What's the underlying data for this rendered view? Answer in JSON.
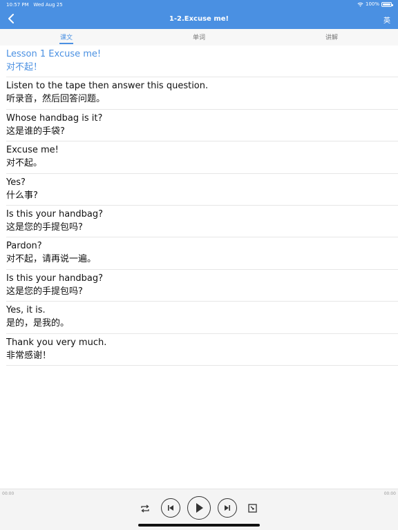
{
  "status_bar": {
    "time": "10:57 PM",
    "date": "Wed Aug 25",
    "battery": "100%"
  },
  "header": {
    "title": "1-2.Excuse me!",
    "lang_toggle": "英",
    "back_icon": "chevron-left-icon"
  },
  "tabs": [
    {
      "label": "课文",
      "active": true
    },
    {
      "label": "单词",
      "active": false
    },
    {
      "label": "讲解",
      "active": false
    }
  ],
  "lines": [
    {
      "en": "Lesson 1 Excuse me!",
      "zh": "对不起！"
    },
    {
      "en": "Listen to the tape then answer this question.",
      "zh": "听录音，然后回答问题。"
    },
    {
      "en": "Whose handbag is it?",
      "zh": "这是谁的手袋?"
    },
    {
      "en": "Excuse me!",
      "zh": "对不起。"
    },
    {
      "en": "Yes?",
      "zh": "什么事?"
    },
    {
      "en": "Is this your handbag?",
      "zh": "这是您的手提包吗?"
    },
    {
      "en": "Pardon?",
      "zh": "对不起，请再说一遍。"
    },
    {
      "en": "Is this your handbag?",
      "zh": "这是您的手提包吗?"
    },
    {
      "en": "Yes, it is.",
      "zh": "是的，是我的。"
    },
    {
      "en": "Thank you very much.",
      "zh": "非常感谢！"
    }
  ],
  "player": {
    "elapsed": "00:00",
    "duration": "00:00",
    "controls": [
      "repeat-icon",
      "previous-icon",
      "play-icon",
      "next-icon",
      "timer-icon"
    ]
  },
  "colors": {
    "accent": "#4a90e2",
    "text": "#111111",
    "divider": "#e6e6e6"
  }
}
